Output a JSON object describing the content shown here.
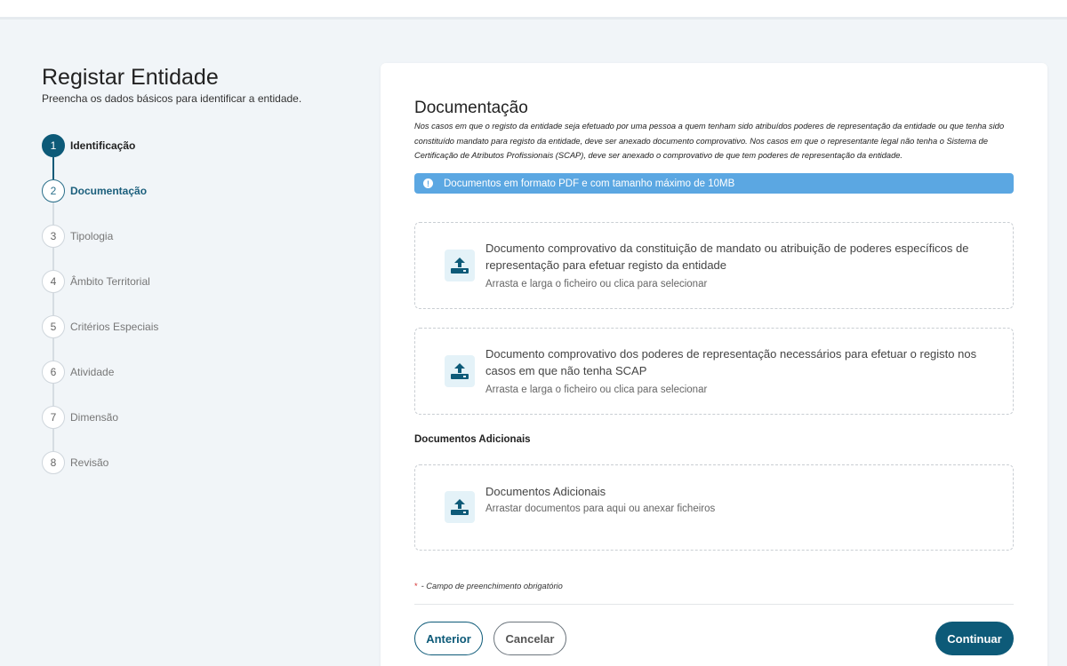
{
  "page": {
    "title": "Registar Entidade",
    "subtitle": "Preencha os dados básicos para identificar a entidade."
  },
  "steps": [
    {
      "number": "1",
      "label": "Identificação",
      "state": "done"
    },
    {
      "number": "2",
      "label": "Documentação",
      "state": "current"
    },
    {
      "number": "3",
      "label": "Tipologia",
      "state": "pending"
    },
    {
      "number": "4",
      "label": "Âmbito Territorial",
      "state": "pending"
    },
    {
      "number": "5",
      "label": "Critérios Especiais",
      "state": "pending"
    },
    {
      "number": "6",
      "label": "Atividade",
      "state": "pending"
    },
    {
      "number": "7",
      "label": "Dimensão",
      "state": "pending"
    },
    {
      "number": "8",
      "label": "Revisão",
      "state": "pending"
    }
  ],
  "section": {
    "title": "Documentação",
    "description": "Nos casos em que o registo da entidade seja efetuado por uma pessoa a quem tenham sido atribuídos poderes de representação da entidade ou que tenha sido constituído mandato para registo da entidade, deve ser anexado documento comprovativo. Nos casos em que o representante legal não tenha o Sistema de Certificação de Atributos Profissionais (SCAP),  deve ser anexado o comprovativo de que tem poderes de representação da entidade.",
    "info_banner": "Documentos em formato PDF e com tamanho máximo de 10MB",
    "info_icon": "!"
  },
  "uploads": [
    {
      "title": "Documento comprovativo da constituição de mandato ou atribuição de poderes específicos de representação para efetuar registo da entidade",
      "hint": "Arrasta e larga o ficheiro ou clica para selecionar"
    },
    {
      "title": "Documento comprovativo dos poderes de representação necessários para efetuar o registo nos casos em que não tenha SCAP",
      "hint": "Arrasta e larga o ficheiro ou clica para selecionar"
    },
    {
      "title": "Documentos Adicionais",
      "hint": "Arrastar documentos para aqui ou anexar ficheiros"
    }
  ],
  "additional": {
    "title": "Documentos Adicionais"
  },
  "required": {
    "asterisk": "*",
    "note": "- Campo de preenchimento obrigatório"
  },
  "buttons": {
    "previous": "Anterior",
    "cancel": "Cancelar",
    "continue": "Continuar"
  },
  "colors": {
    "primary": "#0d5a78",
    "banner": "#5ba7e2",
    "background": "#f1f5f8",
    "required": "#d32f2f"
  }
}
